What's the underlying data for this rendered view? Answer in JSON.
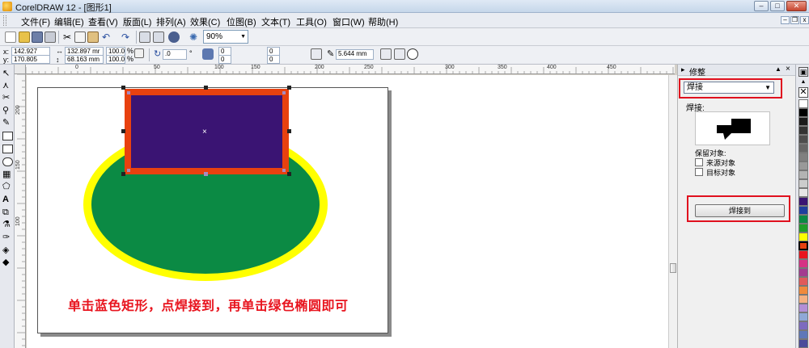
{
  "window": {
    "title": "CorelDRAW 12 - [图形1]",
    "min_label": "–",
    "max_label": "□",
    "close_label": "✕"
  },
  "menu": {
    "items": [
      "文件(F)",
      "编辑(E)",
      "查看(V)",
      "版面(L)",
      "排列(A)",
      "效果(C)",
      "位图(B)",
      "文本(T)",
      "工具(O)",
      "窗口(W)",
      "帮助(H)"
    ],
    "mdi_min": "–",
    "mdi_restore": "❐",
    "mdi_close": "x"
  },
  "toolbar": {
    "zoom": "90%"
  },
  "property_bar": {
    "x_label": "x:",
    "x_value": "142.927 mm",
    "y_label": "y:",
    "y_value": "170.805 mm",
    "w_value": "132.897 mr",
    "h_value": "68.163 mm",
    "scale_x": "100.0",
    "scale_y": "100.0",
    "percent": "%",
    "rotation": ".0",
    "degree": "°",
    "corner_values": [
      "0",
      "0",
      "0",
      "0"
    ],
    "outline_width": "5.644 mm"
  },
  "ruler": {
    "h_labels": [
      "0",
      "50",
      "100",
      "150",
      "200",
      "250",
      "300",
      "350",
      "400",
      "450"
    ],
    "v_labels": [
      "200",
      "150",
      "100"
    ],
    "unit": "毫米"
  },
  "canvas": {
    "instruction_text": "单击蓝色矩形，点焊接到，再单击绿色椭圆即可",
    "colors": {
      "rectangle_fill": "#3a1473",
      "rectangle_outline": "#e8410f",
      "ellipse_fill": "#0b8a44",
      "ellipse_outline": "#ffff00",
      "instruction": "#e8141e"
    }
  },
  "docker": {
    "title": "修整",
    "mode_select": "焊接",
    "preview_label": "焊接:",
    "keep_label": "保留对象:",
    "source_label": "来源对象",
    "target_label": "目标对象",
    "weld_button": "焊接到"
  },
  "palette": {
    "colors": [
      "#ffffff",
      "#000000",
      "#1a1a1a",
      "#333333",
      "#4d4d4d",
      "#666666",
      "#808080",
      "#999999",
      "#b3b3b3",
      "#cccccc",
      "#e6e6e6",
      "#3a1473",
      "#1f3f9e",
      "#0b8a44",
      "#1f9e2a",
      "#ffff00",
      "#e8410f",
      "#e8141e",
      "#d63384",
      "#a33b8f",
      "#e05a5a",
      "#f08a3c",
      "#f4b183",
      "#b38fd6",
      "#8fa8d6",
      "#7d6bbf",
      "#5e78b8",
      "#4b4b9a"
    ]
  }
}
